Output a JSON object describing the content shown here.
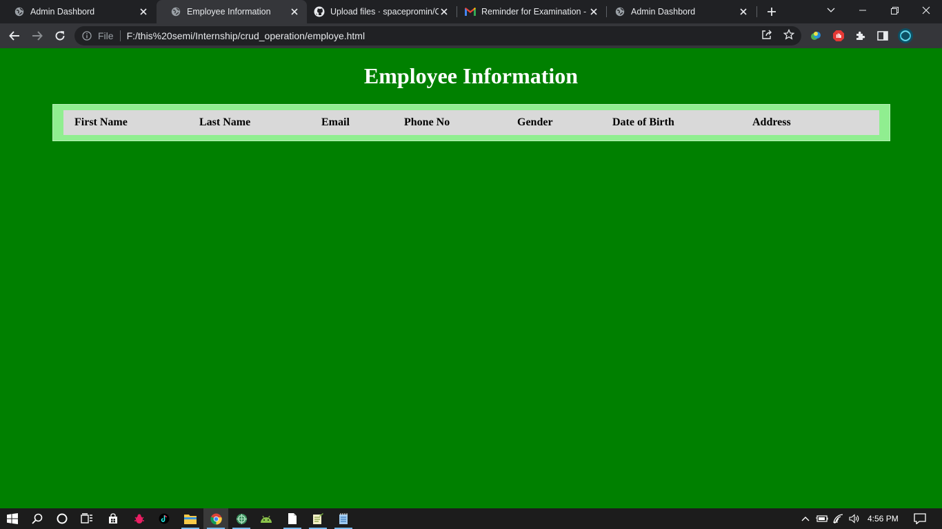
{
  "browser": {
    "tabs": [
      {
        "title": "Admin Dashbord",
        "active": false
      },
      {
        "title": "Employee Information",
        "active": true
      },
      {
        "title": "Upload files · spacepromin/O",
        "active": false
      },
      {
        "title": "Reminder for Examination - a",
        "active": false
      },
      {
        "title": "Admin Dashbord",
        "active": false
      }
    ],
    "address": {
      "scheme": "File",
      "url": "F:/this%20semi/Internship/crud_operation/employe.html"
    }
  },
  "page": {
    "title": "Employee Information",
    "table": {
      "headers": [
        "First Name",
        "Last Name",
        "Email",
        "Phone No",
        "Gender",
        "Date of Birth",
        "Address"
      ],
      "rows": []
    }
  },
  "taskbar": {
    "clock": "4:56 PM"
  },
  "colors": {
    "page_background": "#008000",
    "table_border_band": "#90ee90",
    "header_row": "#d9d9d9",
    "title_text": "#ffffff"
  }
}
